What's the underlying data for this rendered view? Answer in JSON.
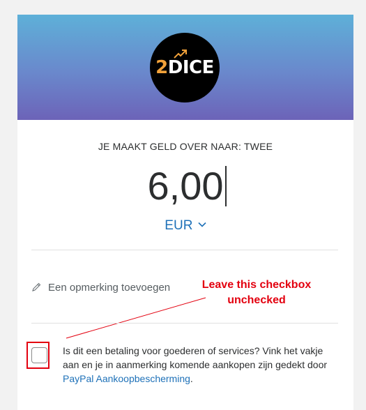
{
  "header": {
    "logo": {
      "num": "2",
      "word": "DICE",
      "accent_color": "#f2a23a",
      "background": "#000000"
    },
    "gradient": [
      "#5eb0d8",
      "#6c63b8"
    ]
  },
  "payment": {
    "recipient_label": "JE MAAKT GELD OVER NAAR: TWEE",
    "amount": "6,00",
    "currency": "EUR",
    "currency_icon": "chevron-down-icon"
  },
  "note": {
    "icon": "pencil-icon",
    "label": "Een opmerking toevoegen"
  },
  "annotation": {
    "line1": "Leave this checkbox",
    "line2": "unchecked",
    "color": "#e3000f"
  },
  "purchase_protection": {
    "checked": false,
    "text": "Is dit een betaling voor goederen of services? Vink het vakje aan en je in aanmerking komende aankopen zijn gedekt door ",
    "link_text": "PayPal Aankoopbescherming",
    "suffix": "."
  },
  "colors": {
    "link": "#1e71b8",
    "text": "#2c2e2f"
  }
}
